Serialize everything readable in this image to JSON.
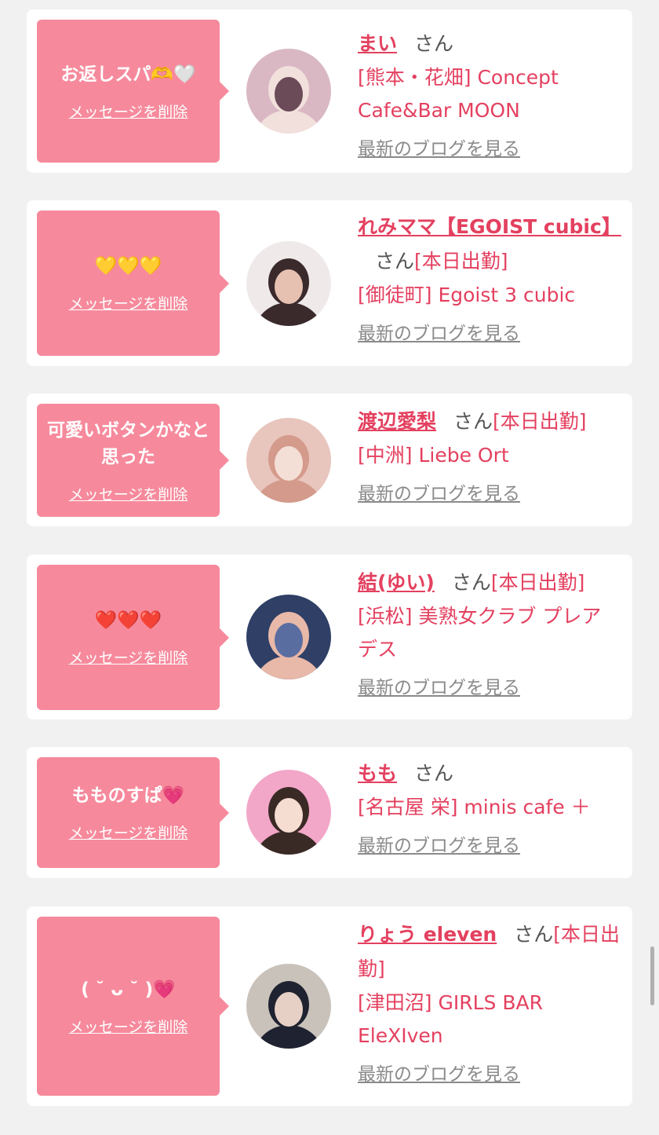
{
  "delete_label": "メッセージを削除",
  "blog_label": "最新のブログを見る",
  "san": "さん",
  "colors": {
    "bubble": "#f68a9c",
    "accent": "#e4405f",
    "background": "#f1f1f1"
  },
  "entries": [
    {
      "message": "お返しスパ🫶🤍",
      "name": "まい",
      "shift": "",
      "shop": "[熊本・花畑] Concept Cafe&Bar MOON",
      "avatar_colors": [
        "#d9b8c4",
        "#f2e0dc",
        "#6b4b58"
      ]
    },
    {
      "message": "💛💛💛",
      "name": "れみママ【EGOIST cubic】",
      "shift": "[本日出勤]",
      "shop": "[御徒町] Egoist 3 cubic",
      "avatar_colors": [
        "#efe9ea",
        "#3a2a2c",
        "#e6c0b0"
      ]
    },
    {
      "message": "可愛いボタンかなと思った",
      "name": "渡辺愛梨",
      "shift": "[本日出勤]",
      "shop": "[中洲] Liebe Ort",
      "avatar_colors": [
        "#e8c5bd",
        "#d49a8c",
        "#f4dfd6"
      ]
    },
    {
      "message": "❤️❤️❤️",
      "name": "結(ゆい)",
      "shift": "[本日出勤]",
      "shop": "[浜松] 美熟女クラブ プレアデス",
      "avatar_colors": [
        "#2f3f66",
        "#e8b8a8",
        "#5a6da0"
      ]
    },
    {
      "message": "もものすぱ💗",
      "name": "もも",
      "shift": "",
      "shop": "[名古屋 栄] minis cafe ＋",
      "avatar_colors": [
        "#f2a6c8",
        "#3a2a26",
        "#f6ddd2"
      ]
    },
    {
      "message": "( ˘ ᴗ ˘ )💗",
      "name": "りょう eleven",
      "shift": "[本日出勤]",
      "shop": "[津田沼] GIRLS BAR EleXIven",
      "avatar_colors": [
        "#c9c2ba",
        "#1f2230",
        "#e6d0c6"
      ]
    }
  ]
}
